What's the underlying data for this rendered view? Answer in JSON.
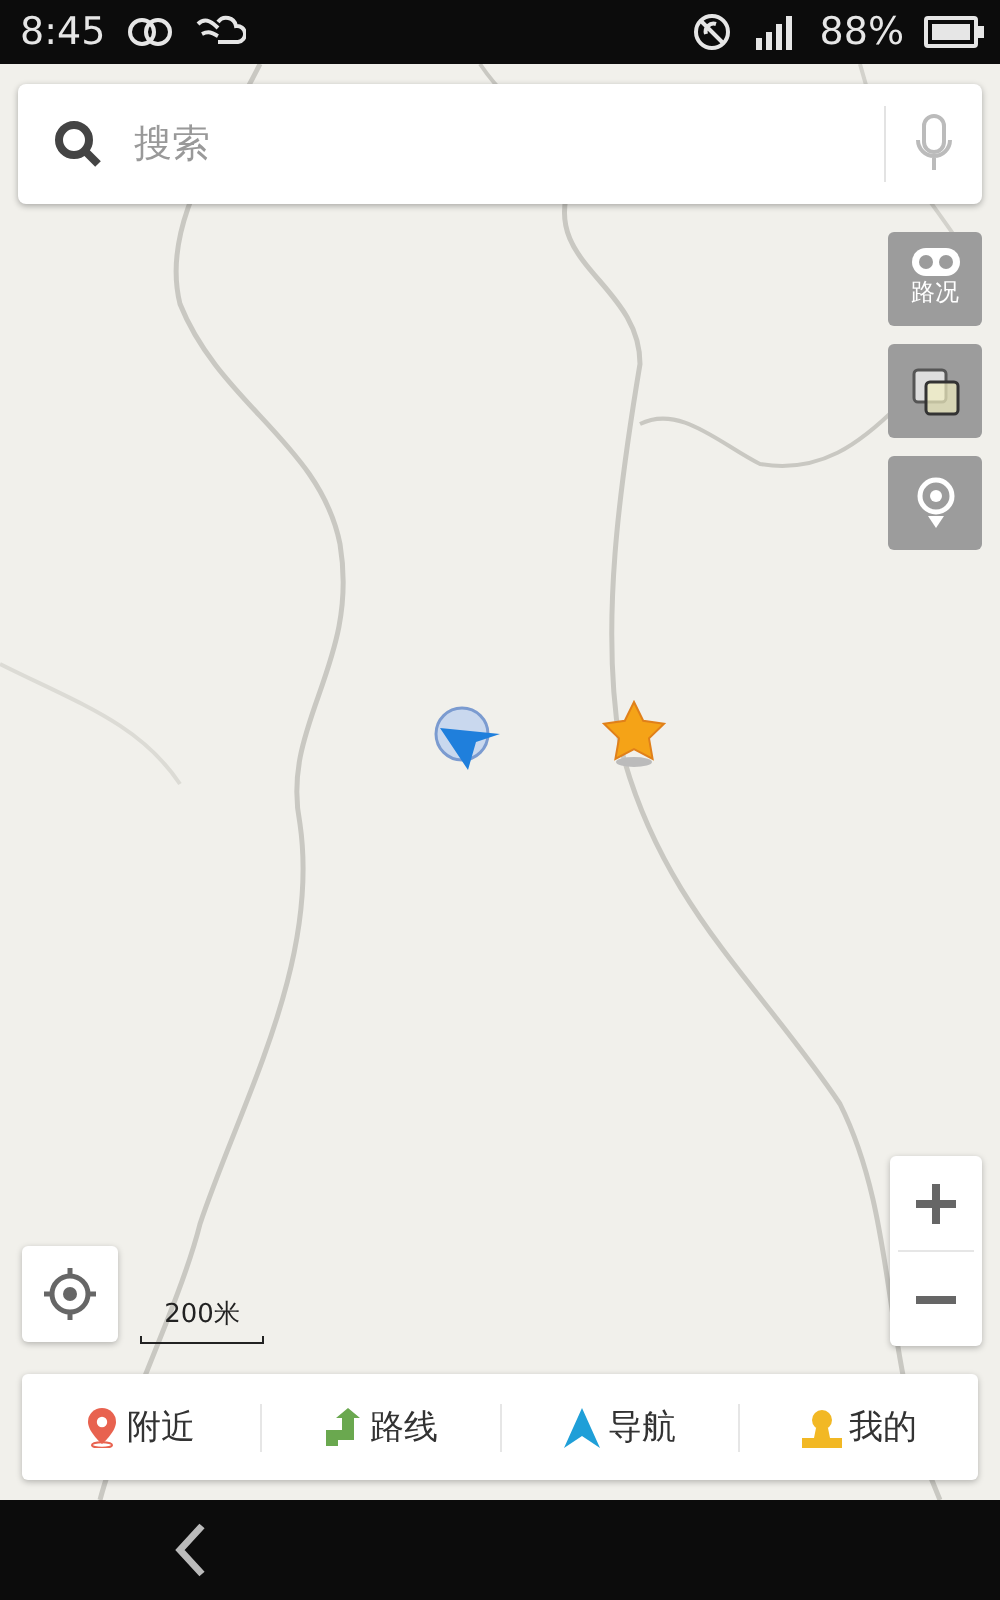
{
  "status_bar": {
    "time": "8:45",
    "battery": "88%"
  },
  "search": {
    "placeholder": "搜索"
  },
  "map_controls": [
    {
      "kind": "traffic",
      "label": "路况"
    },
    {
      "kind": "layers"
    },
    {
      "kind": "marker"
    }
  ],
  "scale": "200米",
  "tabs": [
    {
      "kind": "nearby",
      "label": "附近"
    },
    {
      "kind": "route",
      "label": "路线"
    },
    {
      "kind": "navigate",
      "label": "导航"
    },
    {
      "kind": "mine",
      "label": "我的"
    }
  ]
}
